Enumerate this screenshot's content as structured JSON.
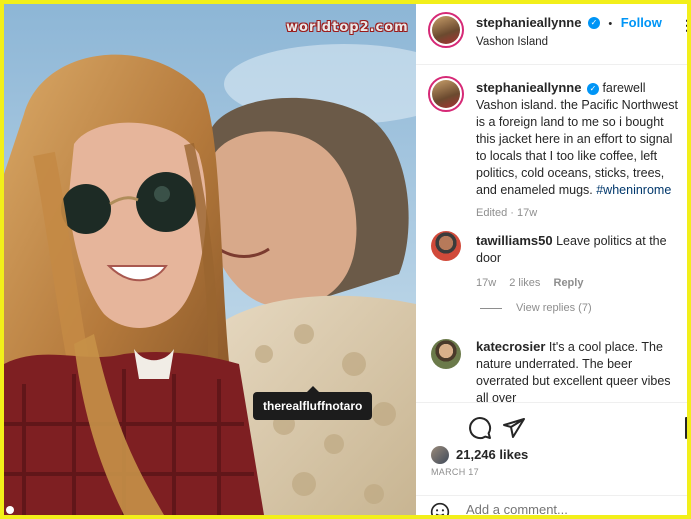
{
  "watermark": "worldtop2.com",
  "photo": {
    "tag_label": "therealfluffnotaro",
    "colors": {
      "sky": "#9cc0db",
      "hair": "#c08a4a",
      "jacket_red": "#7e1f22",
      "sherpa": "#d9c9ae"
    }
  },
  "post": {
    "author": "stephanieallynne",
    "follow_label": "Follow",
    "location": "Vashon Island",
    "separator": "•",
    "caption_text": "farewell Vashon island. the Pacific Northwest is a foreign land to me so i bought this jacket here in an effort to signal to locals that I too like coffee, left politics, cold oceans, sticks, trees, and enameled mugs.",
    "hashtag": "#wheninrome",
    "caption_meta": "Edited · 17w"
  },
  "comments": [
    {
      "user": "tawilliams50",
      "text": "Leave politics at the door",
      "age": "17w",
      "likes": "2 likes",
      "reply": "Reply",
      "view_replies": "View replies (7)"
    },
    {
      "user": "katecrosier",
      "text": "It's a cool place. The nature underrated. The beer overrated but excellent queer vibes all over"
    }
  ],
  "stats": {
    "likes": "21,246 likes",
    "date": "MARCH 17"
  },
  "composer": {
    "placeholder": "Add a comment..."
  },
  "icons": [
    "verified-icon",
    "more-icon",
    "comment-icon",
    "share-icon",
    "save-icon",
    "emoji-icon"
  ]
}
